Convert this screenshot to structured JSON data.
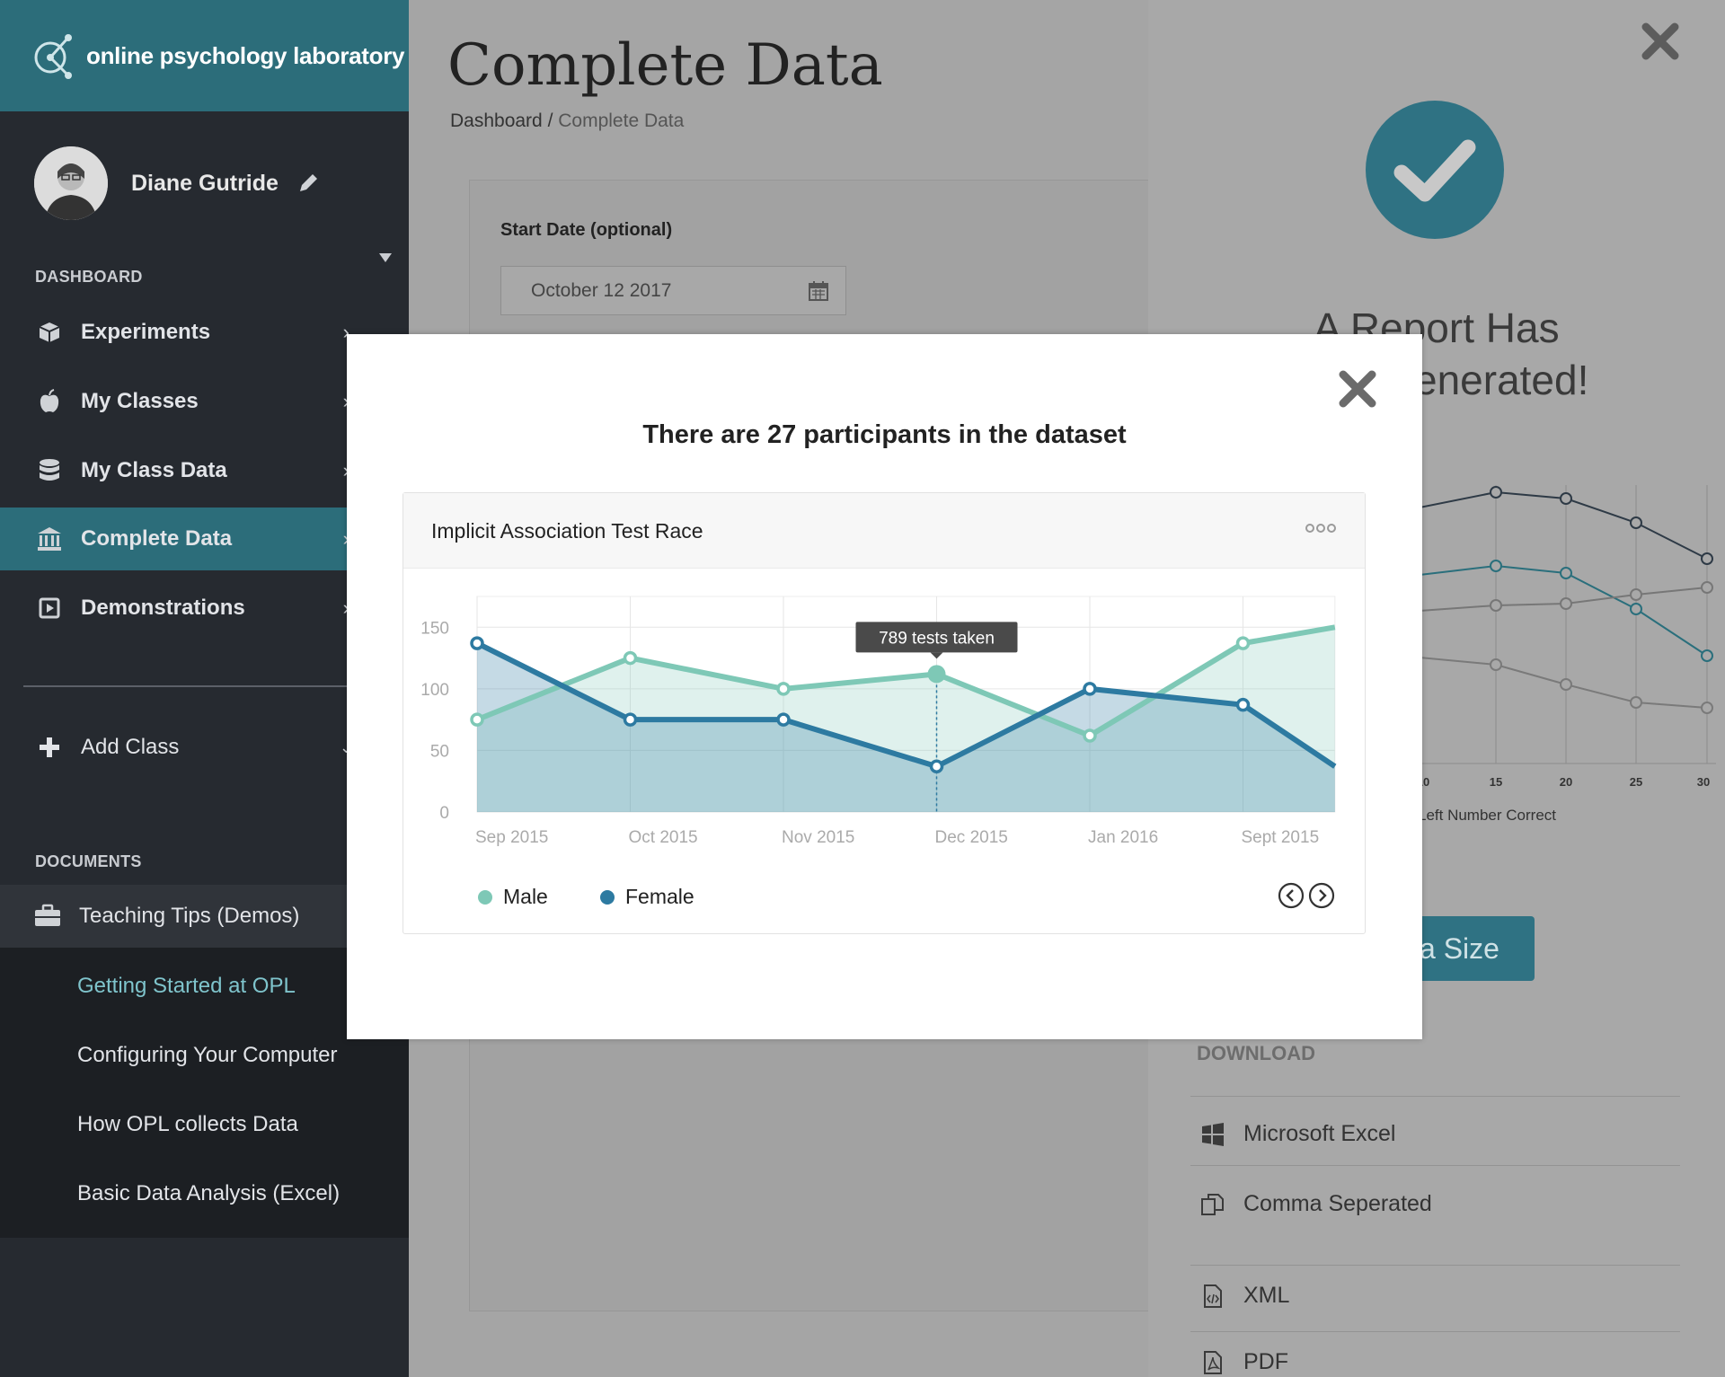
{
  "brand": {
    "name": "online psychology laboratory"
  },
  "user": {
    "name": "Diane Gutride"
  },
  "sidebar": {
    "dashboard_label": "DASHBOARD",
    "items": [
      {
        "label": "Experiments",
        "icon": "cube-icon"
      },
      {
        "label": "My Classes",
        "icon": "apple-icon"
      },
      {
        "label": "My Class Data",
        "icon": "database-icon"
      },
      {
        "label": "Complete Data",
        "icon": "bank-icon",
        "active": true
      },
      {
        "label": "Demonstrations",
        "icon": "play-square-icon"
      }
    ],
    "add_class": "Add Class",
    "documents_label": "DOCUMENTS",
    "documents": {
      "group": "Teaching Tips (Demos)",
      "items": [
        "Getting Started at OPL",
        "Configuring Your Computer",
        "How OPL collects Data",
        "Basic Data Analysis (Excel)"
      ]
    }
  },
  "main": {
    "title": "Complete Data",
    "breadcrumb_root": "Dashboard /",
    "breadcrumb_current": "Complete Data",
    "start_date_label": "Start Date (optional)",
    "start_date_value": "October 12 2017"
  },
  "report": {
    "title": "A Report Has Been Generated!",
    "visible_title_line1": "A Report Has",
    "visible_title_line2": "enerated!",
    "bg_axis_ticks": [
      "10",
      "15",
      "20",
      "25",
      "30"
    ],
    "bg_axis_label": "Left Number Correct",
    "data_size_button": "a Size",
    "download_label": "DOWNLOAD",
    "downloads": [
      {
        "label": "Microsoft Excel",
        "icon": "windows-icon"
      },
      {
        "label": "Comma Seperated",
        "icon": "copy-icon"
      },
      {
        "label": "XML",
        "icon": "file-code-icon"
      },
      {
        "label": "PDF",
        "icon": "file-pdf-icon"
      }
    ]
  },
  "modal": {
    "heading": "There are 27 participants in the dataset",
    "chart_title": "Implicit Association Test Race",
    "tooltip": "789 tests taken",
    "legend_male": "Male",
    "legend_female": "Female"
  },
  "colors": {
    "teal_dark": "#2c6d7a",
    "male": "#7ec8b6",
    "female": "#2d7aa1"
  },
  "chart_data": {
    "type": "area",
    "categories": [
      "Sep 2015",
      "Oct 2015",
      "Nov 2015",
      "Dec 2015",
      "Jan 2016",
      "Sept 2015"
    ],
    "x": [
      0,
      1,
      2,
      3,
      4,
      5,
      5.6
    ],
    "series": [
      {
        "name": "Male",
        "values": [
          75,
          125,
          100,
          112,
          62,
          137,
          150
        ]
      },
      {
        "name": "Female",
        "values": [
          137,
          75,
          75,
          37,
          100,
          87,
          37
        ]
      }
    ],
    "yticks": [
      0,
      50,
      100,
      150
    ],
    "ylim": [
      0,
      175
    ],
    "grid": true,
    "legend": "bottom-left",
    "highlight_index": 3
  }
}
